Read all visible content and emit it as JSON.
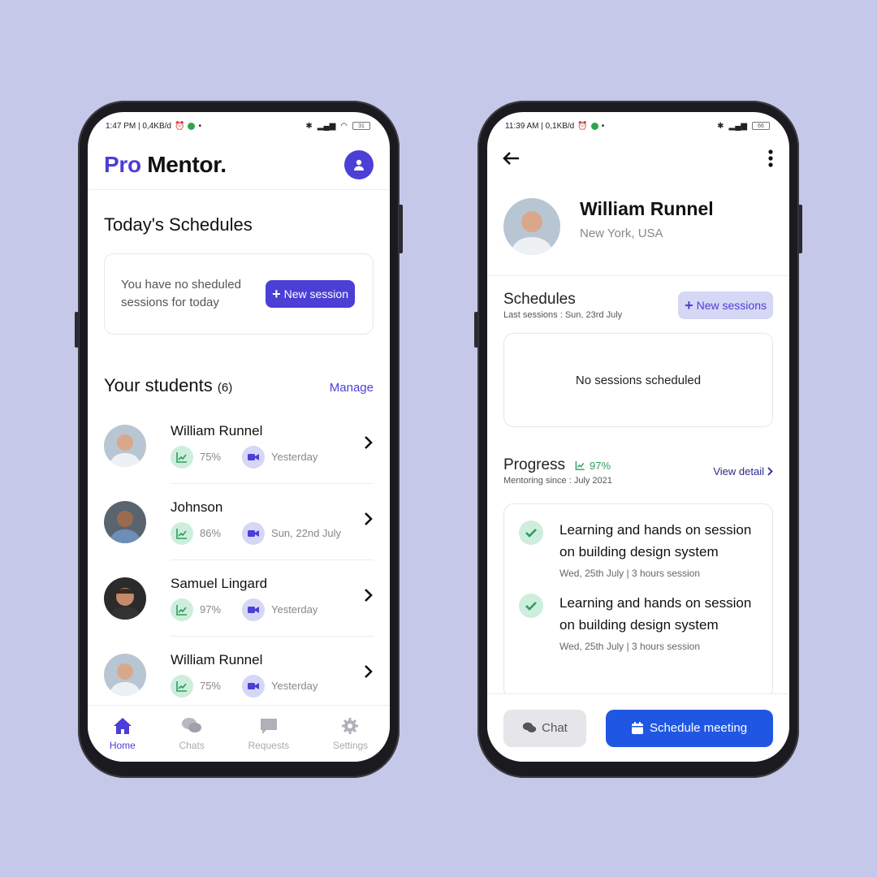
{
  "left": {
    "status": {
      "time_info": "1:47 PM | 0,4KB/d",
      "battery": "31"
    },
    "brand": {
      "pro": "Pro",
      "mentor": "Mentor."
    },
    "today_title": "Today's Schedules",
    "empty_message": "You have no sheduled sessions for today",
    "new_session_label": "New session",
    "students_title": "Your students",
    "students_count": "(6)",
    "manage_label": "Manage",
    "students": [
      {
        "name": "William Runnel",
        "progress": "75%",
        "last": "Yesterday"
      },
      {
        "name": "Johnson",
        "progress": "86%",
        "last": "Sun, 22nd July"
      },
      {
        "name": "Samuel Lingard",
        "progress": "97%",
        "last": "Yesterday"
      },
      {
        "name": "William Runnel",
        "progress": "75%",
        "last": "Yesterday"
      }
    ],
    "nav": [
      {
        "label": "Home",
        "icon": "home-icon"
      },
      {
        "label": "Chats",
        "icon": "chats-icon"
      },
      {
        "label": "Requests",
        "icon": "requests-icon"
      },
      {
        "label": "Settings",
        "icon": "settings-icon"
      }
    ]
  },
  "right": {
    "status": {
      "time_info": "11:39 AM | 0,1KB/d",
      "battery": "66"
    },
    "profile": {
      "name": "William Runnel",
      "location": "New York, USA"
    },
    "schedules_title": "Schedules",
    "last_sessions": "Last sessions : Sun, 23rd July",
    "new_sessions_label": "New sessions",
    "no_sessions": "No sessions scheduled",
    "progress_title": "Progress",
    "progress_pct": "97%",
    "mentoring_since": "Mentoring since : July 2021",
    "view_detail": "View detail",
    "tasks": [
      {
        "title": "Learning and hands on session on building design system",
        "meta": "Wed, 25th July | 3 hours session"
      },
      {
        "title": "Learning and hands on session on building design system",
        "meta": "Wed, 25th July | 3 hours session"
      }
    ],
    "chat_label": "Chat",
    "schedule_label": "Schedule meeting"
  },
  "colors": {
    "accent": "#4b3fd6",
    "primary_blue": "#1f57e3",
    "success": "#2e9d5c",
    "background": "#c5c8e8"
  }
}
